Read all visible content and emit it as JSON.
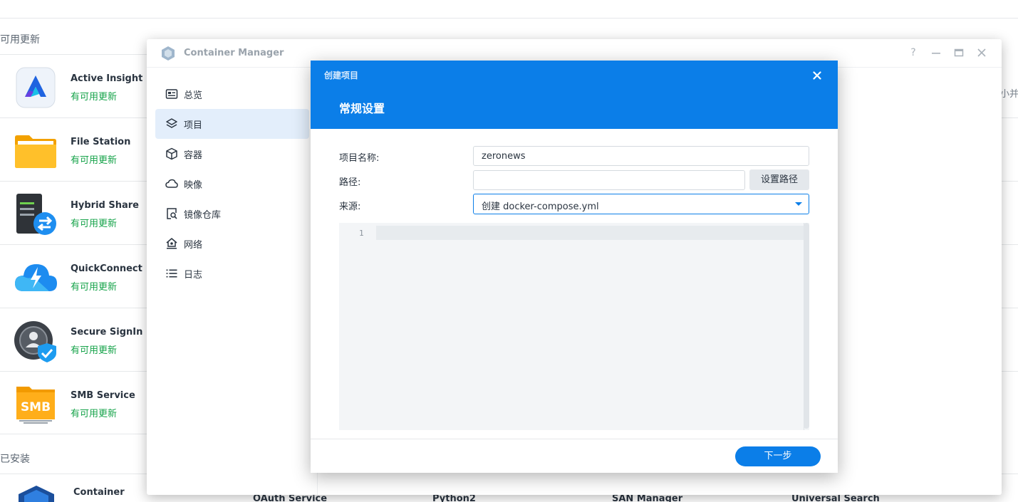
{
  "background": {
    "updates_section_title": "可用更新",
    "installed_section_title": "已安装",
    "right_clipped_text": "小并排",
    "packages": [
      {
        "name": "Active Insight",
        "status": "有可用更新",
        "icon": "active-insight-icon"
      },
      {
        "name": "File Station",
        "status": "有可用更新",
        "icon": "folder-icon"
      },
      {
        "name": "Hybrid Share",
        "status": "有可用更新",
        "icon": "hybrid-share-icon"
      },
      {
        "name": "QuickConnect",
        "status": "有可用更新",
        "icon": "cloud-bolt-icon"
      },
      {
        "name": "Secure SignIn",
        "status": "有可用更新",
        "icon": "secure-signin-icon"
      },
      {
        "name": "SMB Service",
        "status": "有可用更新",
        "icon": "smb-icon",
        "icon_text": "SMB"
      }
    ],
    "installed": [
      "Container",
      "OAuth Service",
      "Python2",
      "SAN Manager",
      "Universal Search"
    ]
  },
  "window": {
    "title": "Container Manager",
    "controls": [
      "help-icon",
      "minimize-icon",
      "maximize-icon",
      "close-icon"
    ],
    "help_glyph": "?",
    "sidebar": {
      "active_index": 1,
      "items": [
        {
          "label": "总览",
          "icon": "overview-icon"
        },
        {
          "label": "项目",
          "icon": "layers-icon"
        },
        {
          "label": "容器",
          "icon": "cube-icon"
        },
        {
          "label": "映像",
          "icon": "cloud-icon"
        },
        {
          "label": "镜像仓库",
          "icon": "registry-search-icon"
        },
        {
          "label": "网络",
          "icon": "network-icon"
        },
        {
          "label": "日志",
          "icon": "list-icon"
        }
      ]
    }
  },
  "dialog": {
    "title": "创建项目",
    "step_title": "常规设置",
    "fields": {
      "project_name_label": "项目名称:",
      "project_name_value": "zeronews",
      "path_label": "路径:",
      "path_value": "",
      "set_path_button": "设置路径",
      "source_label": "来源:",
      "source_value": "创建 docker-compose.yml"
    },
    "editor": {
      "line_numbers": [
        "1"
      ],
      "content": ""
    },
    "next_button": "下一步"
  },
  "colors": {
    "accent": "#0b7ee8",
    "status_green": "#16a34a",
    "active_nav_bg": "#e3eefb"
  }
}
